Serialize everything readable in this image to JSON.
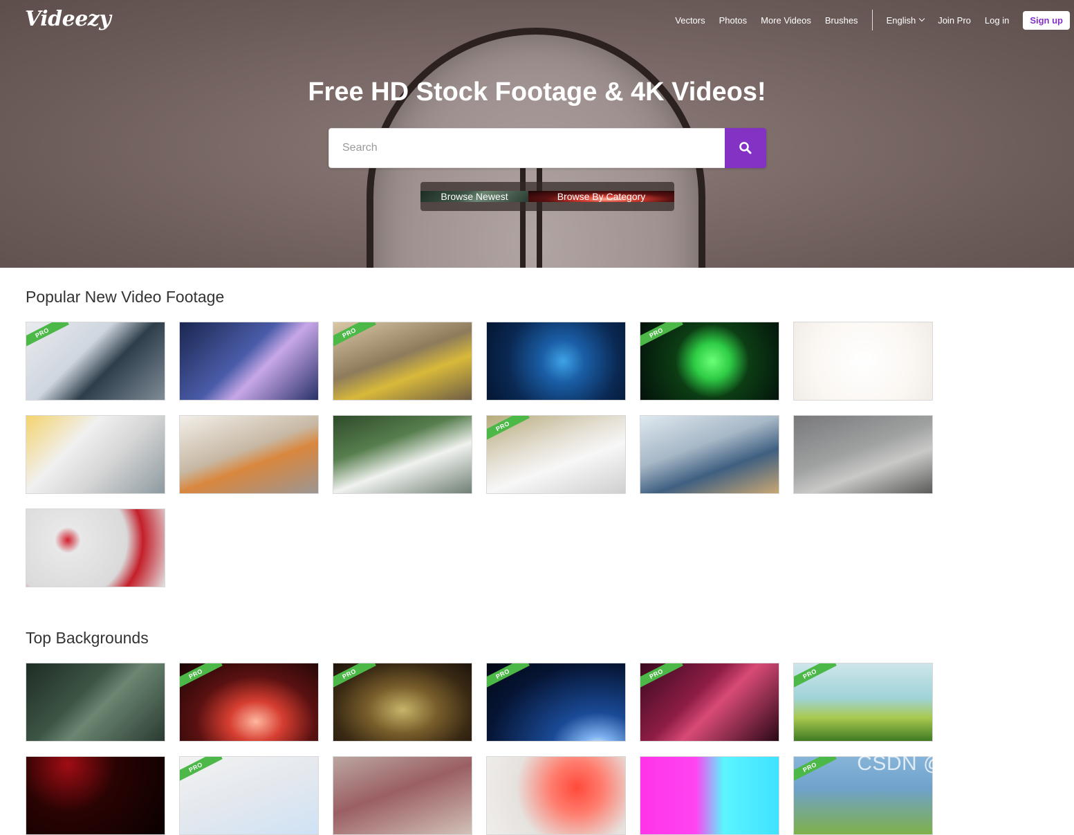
{
  "header": {
    "logo": "Videezy",
    "nav": {
      "vectors": "Vectors",
      "photos": "Photos",
      "more_videos": "More Videos",
      "brushes": "Brushes",
      "language": "English",
      "join_pro": "Join Pro",
      "log_in": "Log in",
      "sign_up": "Sign up"
    }
  },
  "hero": {
    "headline": "Free HD Stock Footage & 4K Videos!",
    "search": {
      "placeholder": "Search"
    },
    "browse_newest": "Browse Newest",
    "browse_by_category": "Browse By Category"
  },
  "sections": [
    {
      "title": "Popular New Video Footage",
      "items": [
        {
          "badge": "PRO"
        },
        {
          "badge": ""
        },
        {
          "badge": "PRO"
        },
        {
          "badge": ""
        },
        {
          "badge": "PRO"
        },
        {
          "badge": ""
        },
        {
          "badge": ""
        },
        {
          "badge": ""
        },
        {
          "badge": ""
        },
        {
          "badge": "PRO"
        },
        {
          "badge": ""
        },
        {
          "badge": ""
        },
        {
          "badge": ""
        }
      ]
    },
    {
      "title": "Top Backgrounds",
      "items": [
        {
          "badge": ""
        },
        {
          "badge": "PRO"
        },
        {
          "badge": "PRO"
        },
        {
          "badge": "PRO"
        },
        {
          "badge": "PRO"
        },
        {
          "badge": "PRO"
        },
        {
          "badge": ""
        },
        {
          "badge": "PRO"
        },
        {
          "badge": ""
        },
        {
          "badge": ""
        },
        {
          "badge": ""
        },
        {
          "badge": "PRO"
        }
      ]
    }
  ],
  "watermark": "CSDN @黑科技研究僧",
  "colors": {
    "accent": "#8332c4",
    "pro_badge": "#4cb848"
  },
  "icons": {
    "search": "search-icon"
  }
}
